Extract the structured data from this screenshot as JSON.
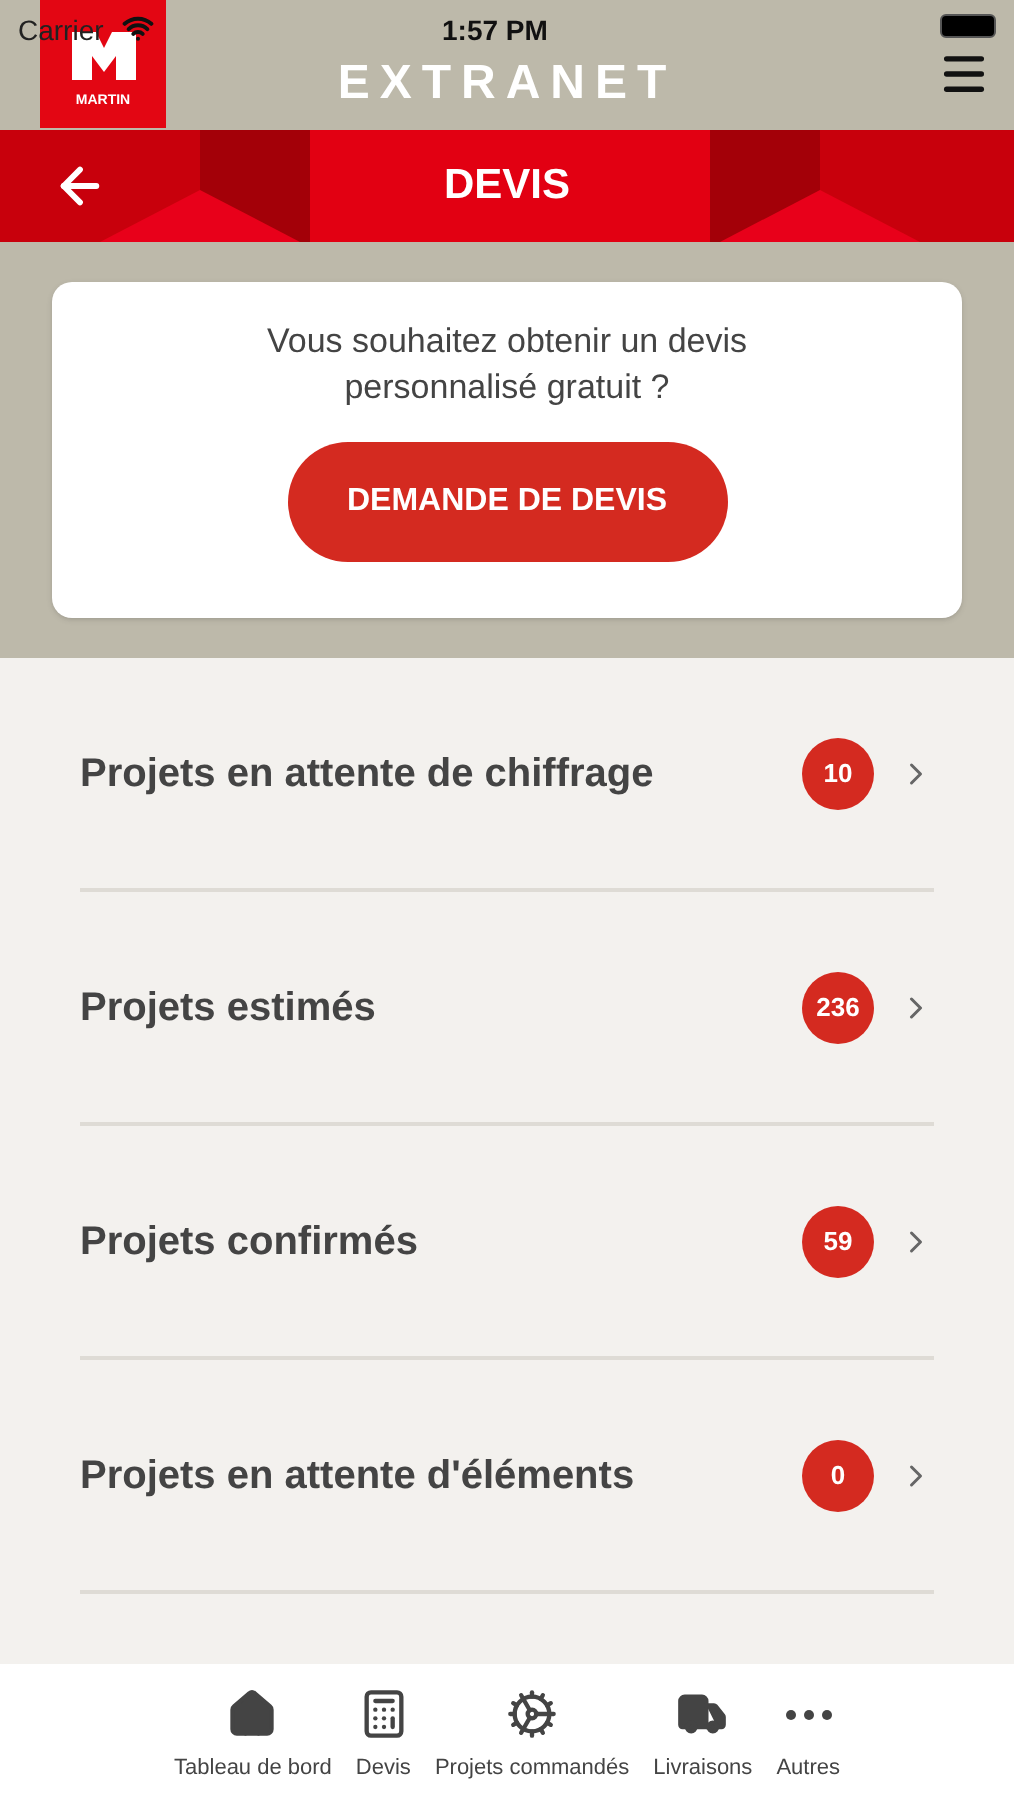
{
  "status_bar": {
    "carrier": "Carrier",
    "time": "1:57 PM"
  },
  "logo": {
    "text": "MARTIN"
  },
  "header": {
    "title": "EXTRANET"
  },
  "page": {
    "title": "DEVIS"
  },
  "promo": {
    "text": "Vous souhaitez obtenir un devis personnalisé gratuit ?",
    "button": "DEMANDE DE DEVIS"
  },
  "list": [
    {
      "label": "Projets en attente de chiffrage",
      "count": "10"
    },
    {
      "label": "Projets estimés",
      "count": "236"
    },
    {
      "label": "Projets confirmés",
      "count": "59"
    },
    {
      "label": "Projets en attente d'éléments",
      "count": "0"
    }
  ],
  "tabs": [
    {
      "kind": "home",
      "label": "Tableau de bord"
    },
    {
      "kind": "calculator",
      "label": "Devis"
    },
    {
      "kind": "gear",
      "label": "Projets commandés"
    },
    {
      "kind": "truck",
      "label": "Livraisons"
    },
    {
      "kind": "more",
      "label": "Autres"
    }
  ]
}
